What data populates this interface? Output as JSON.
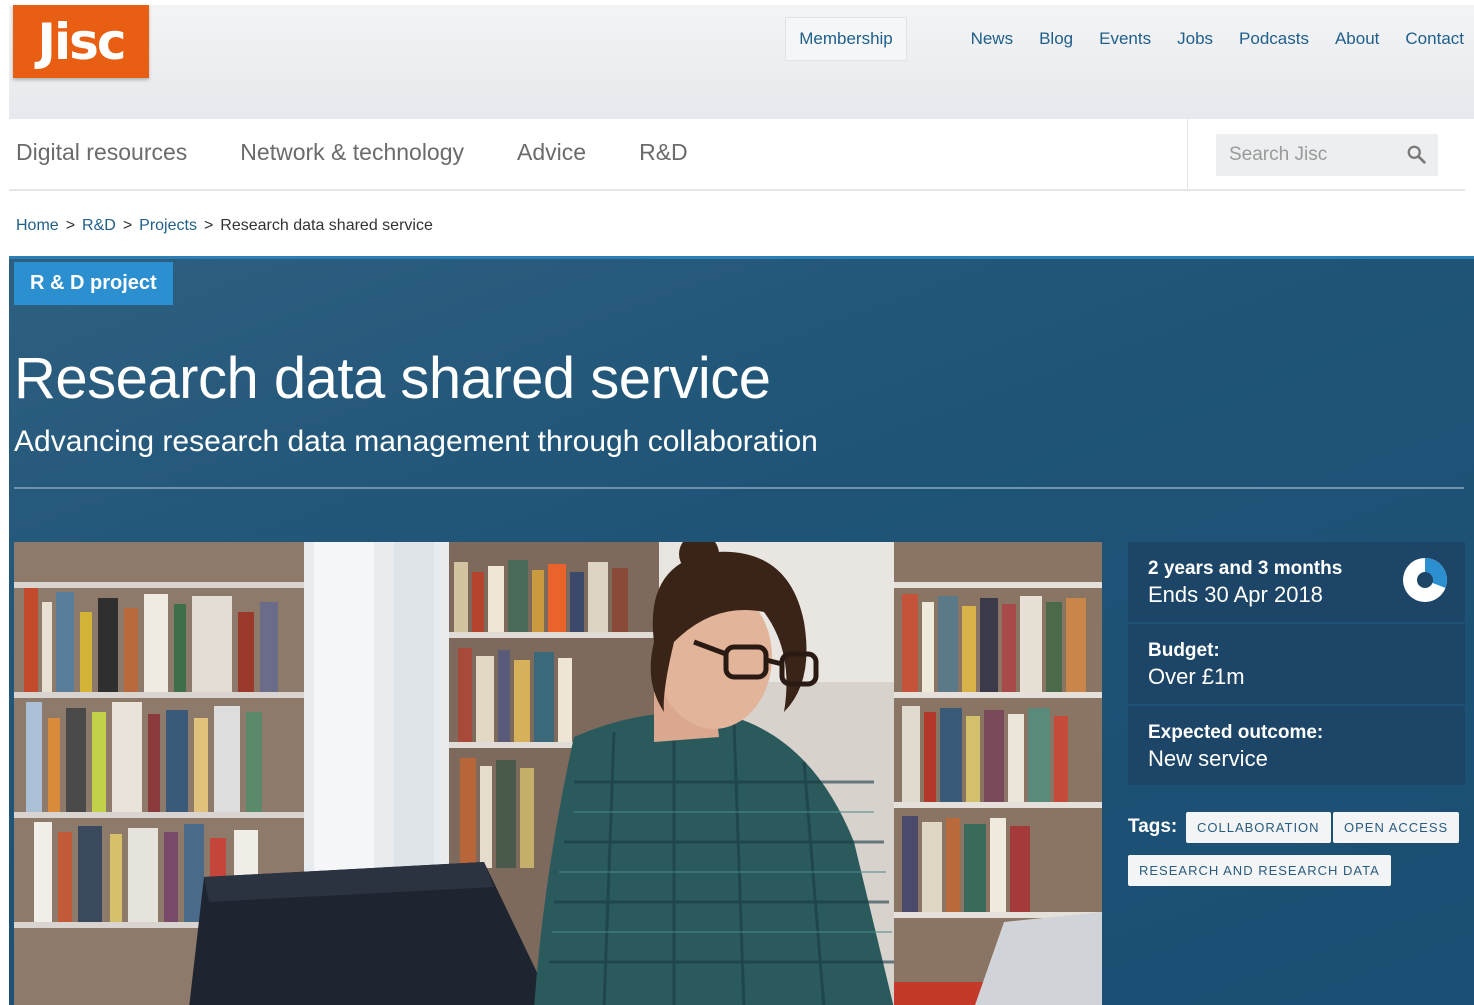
{
  "header": {
    "logo_text": "Jisc",
    "membership_label": "Membership",
    "util_nav": [
      "News",
      "Blog",
      "Events",
      "Jobs",
      "Podcasts",
      "About",
      "Contact"
    ]
  },
  "main_nav": {
    "items": [
      "Digital resources",
      "Network & technology",
      "Advice",
      "R&D"
    ]
  },
  "search": {
    "placeholder": "Search Jisc",
    "icon": "search-icon"
  },
  "breadcrumb": {
    "items": [
      "Home",
      "R&D",
      "Projects"
    ],
    "separator": ">",
    "current": "Research data shared service"
  },
  "hero": {
    "badge": "R & D project",
    "title": "Research data shared service",
    "subtitle": "Advancing research data management through collaboration"
  },
  "info": {
    "duration_label": "2 years and 3 months",
    "duration_value": "Ends 30 Apr 2018",
    "budget_label": "Budget:",
    "budget_value": "Over £1m",
    "outcome_label": "Expected outcome:",
    "outcome_value": "New service"
  },
  "tags": {
    "label": "Tags:",
    "items": [
      "COLLABORATION",
      "OPEN ACCESS",
      "RESEARCH AND RESEARCH DATA"
    ]
  },
  "colors": {
    "brand_orange": "#e85e13",
    "link_blue": "#1f5f8b",
    "hero_blue": "#1f5477",
    "badge_blue": "#2b8fd0",
    "card_blue": "#1c4567"
  }
}
